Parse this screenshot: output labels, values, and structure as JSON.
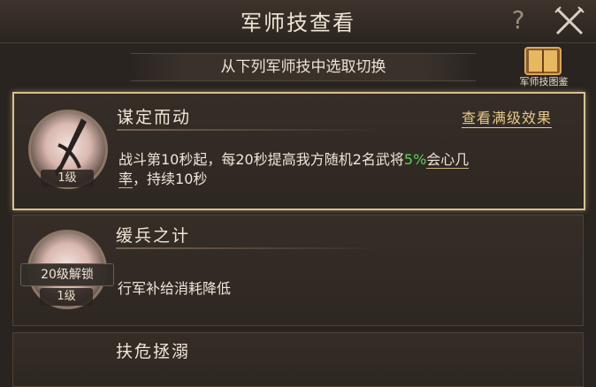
{
  "header": {
    "title": "军师技查看",
    "help_glyph": "?"
  },
  "subtitle": "从下列军师技中选取切换",
  "encyclopedia_label": "军师技图鉴",
  "skills": [
    {
      "name": "谋定而动",
      "link": "查看满级效果",
      "level": "1级",
      "desc_before": "战斗第10秒起，每20秒提高我方随机2名武将",
      "desc_highlight": "5%",
      "desc_underlined": "会心几",
      "desc_line2_underlined": "率",
      "desc_after": "，持续10秒",
      "highlight_color": "#5fd15a"
    },
    {
      "name": "缓兵之计",
      "unlock": "20级解锁",
      "level": "1级",
      "desc": "行军补给消耗降低"
    },
    {
      "name": "扶危拯溺"
    }
  ]
}
